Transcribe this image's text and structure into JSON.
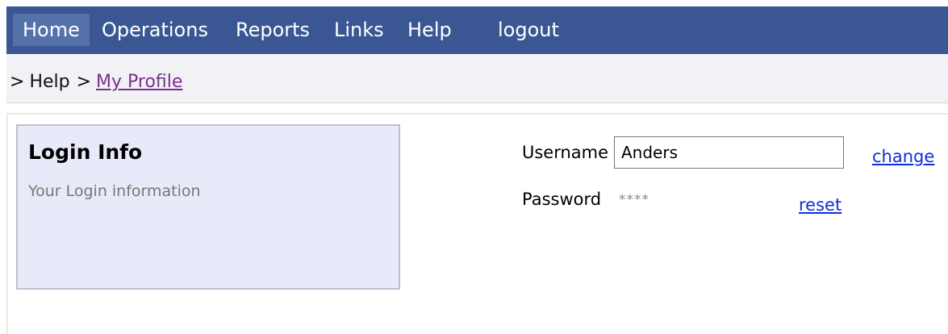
{
  "nav": {
    "items": [
      {
        "label": "Home"
      },
      {
        "label": "Operations"
      },
      {
        "label": "Reports"
      },
      {
        "label": "Links"
      },
      {
        "label": "Help"
      },
      {
        "label": "logout"
      }
    ]
  },
  "breadcrumb": {
    "separator": ">",
    "items": [
      {
        "label": "Help"
      },
      {
        "label": "My Profile"
      }
    ]
  },
  "login_info": {
    "title": "Login Info",
    "subtitle": "Your Login information"
  },
  "form": {
    "username_label": "Username",
    "username_value": "Anders",
    "change_link": "change",
    "password_label": "Password",
    "password_mask": "****",
    "reset_link": "reset"
  },
  "colors": {
    "nav_background": "#3a5794",
    "nav_active": "#5471aa",
    "breadcrumb_background": "#f2f2f6",
    "info_box_background": "#e8eaf9",
    "link": "#0d2fd6",
    "visited_link": "#7a2f8c"
  }
}
